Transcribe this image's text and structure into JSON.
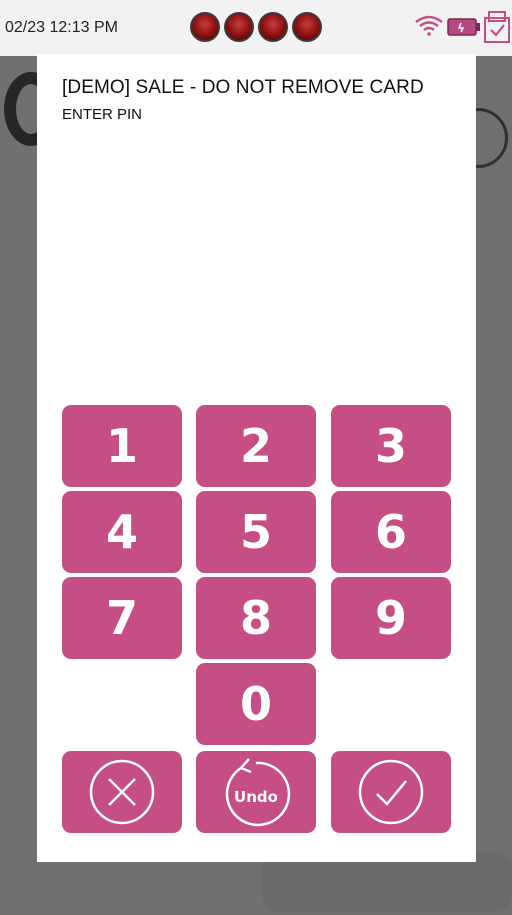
{
  "status_bar": {
    "datetime": "02/23 12:13 PM",
    "led_count": 4,
    "icons": [
      "wifi-icon",
      "battery-icon",
      "receipt-check-icon"
    ]
  },
  "dialog": {
    "title": "[DEMO] SALE - DO NOT REMOVE CARD",
    "subtitle": "ENTER PIN"
  },
  "keypad": {
    "keys": [
      "1",
      "2",
      "3",
      "4",
      "5",
      "6",
      "7",
      "8",
      "9",
      "0"
    ],
    "cancel_icon": "cancel-x-icon",
    "undo_label": "Undo",
    "confirm_icon": "confirm-check-icon"
  },
  "colors": {
    "key": "#c54e85",
    "overlay": "#707070",
    "led": "#8a1010"
  }
}
